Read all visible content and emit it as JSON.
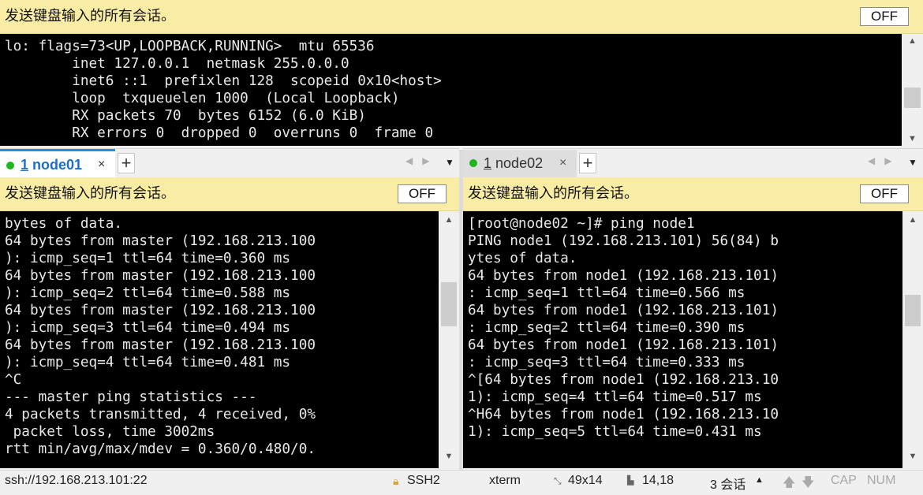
{
  "top_pane": {
    "broadcast_text": "发送键盘输入的所有会话。",
    "off_label": "OFF",
    "lines": [
      "lo: flags=73<UP,LOOPBACK,RUNNING>  mtu 65536",
      "        inet 127.0.0.1  netmask 255.0.0.0",
      "        inet6 ::1  prefixlen 128  scopeid 0x10<host>",
      "        loop  txqueuelen 1000  (Local Loopback)",
      "        RX packets 70  bytes 6152 (6.0 KiB)",
      "        RX errors 0  dropped 0  overruns 0  frame 0"
    ]
  },
  "left_pane": {
    "tab_number": "1",
    "tab_name": "node01",
    "close_symbol": "×",
    "add_symbol": "+",
    "broadcast_text": "发送键盘输入的所有会话。",
    "off_label": "OFF",
    "lines": [
      "bytes of data.",
      "64 bytes from master (192.168.213.100",
      "): icmp_seq=1 ttl=64 time=0.360 ms",
      "64 bytes from master (192.168.213.100",
      "): icmp_seq=2 ttl=64 time=0.588 ms",
      "64 bytes from master (192.168.213.100",
      "): icmp_seq=3 ttl=64 time=0.494 ms",
      "64 bytes from master (192.168.213.100",
      "): icmp_seq=4 ttl=64 time=0.481 ms",
      "^C",
      "--- master ping statistics ---",
      "4 packets transmitted, 4 received, 0%",
      " packet loss, time 3002ms",
      "rtt min/avg/max/mdev = 0.360/0.480/0."
    ]
  },
  "right_pane": {
    "tab_number": "1",
    "tab_name": "node02",
    "close_symbol": "×",
    "add_symbol": "+",
    "broadcast_text": "发送键盘输入的所有会话。",
    "off_label": "OFF",
    "lines": [
      "[root@node02 ~]# ping node1",
      "PING node1 (192.168.213.101) 56(84) b",
      "ytes of data.",
      "64 bytes from node1 (192.168.213.101)",
      ": icmp_seq=1 ttl=64 time=0.566 ms",
      "64 bytes from node1 (192.168.213.101)",
      ": icmp_seq=2 ttl=64 time=0.390 ms",
      "64 bytes from node1 (192.168.213.101)",
      ": icmp_seq=3 ttl=64 time=0.333 ms",
      "^[64 bytes from node1 (192.168.213.10",
      "1): icmp_seq=4 ttl=64 time=0.517 ms",
      "^H64 bytes from node1 (192.168.213.10",
      "1): icmp_seq=5 ttl=64 time=0.431 ms"
    ]
  },
  "status_bar": {
    "connection": "ssh://192.168.213.101:22",
    "protocol": "SSH2",
    "terminal_type": "xterm",
    "size": "49x14",
    "cursor_pos": "14,18",
    "sessions": "3 会话",
    "cap": "CAP",
    "num": "NUM"
  },
  "colors": {
    "broadcast_bg": "#f9eda6",
    "terminal_bg": "#000000",
    "terminal_fg": "#e8e8e8",
    "active_tab_accent": "#1e8fd8",
    "status_dot": "#1fb51f"
  }
}
